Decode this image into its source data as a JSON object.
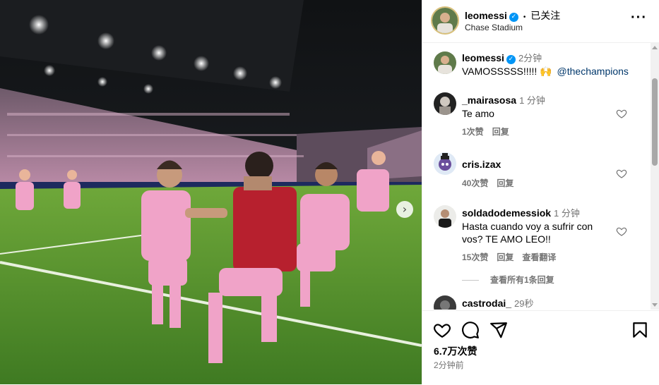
{
  "photo": {
    "next_icon": "chevron-right"
  },
  "header": {
    "username": "leomessi",
    "separator": "•",
    "follow_label": "已关注",
    "location": "Chase Stadium",
    "more_icon": "more-horizontal"
  },
  "caption": {
    "username": "leomessi",
    "time": "2分钟",
    "text": "VAMOSSSSS!!!!! 🙌",
    "mention": "@thechampions"
  },
  "comments": [
    {
      "username": "_mairasosa",
      "time": "1 分钟",
      "text": "Te amo",
      "likes": "1次赞",
      "reply": "回复",
      "translate": ""
    },
    {
      "username": "cris.izax",
      "time": "",
      "text": "",
      "likes": "40次赞",
      "reply": "回复",
      "translate": ""
    },
    {
      "username": "soldadodemessiok",
      "time": "1 分钟",
      "text": "Hasta cuando voy a sufrir con vos? TE AMO LEO!!",
      "likes": "15次赞",
      "reply": "回复",
      "translate": "查看翻译"
    },
    {
      "username": "castrodai_",
      "time": "29秒",
      "text": "",
      "likes": "",
      "reply": "",
      "translate": ""
    }
  ],
  "view_replies": "查看所有1条回复",
  "footer": {
    "likes": "6.7万次赞",
    "time_ago": "2分钟前"
  },
  "colors": {
    "link": "#00376b",
    "verified": "#0095f6",
    "muted": "#737373",
    "kit_pink": "#f0a3c8"
  }
}
